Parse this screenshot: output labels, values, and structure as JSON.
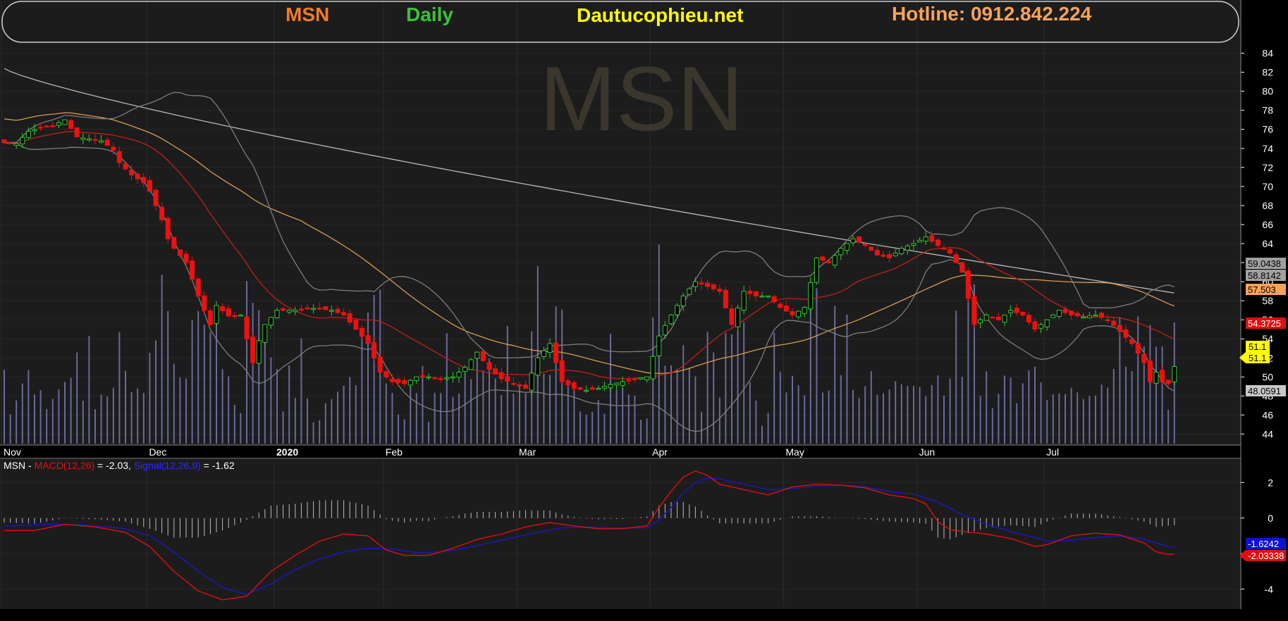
{
  "header": {
    "symbol": "MSN",
    "timeframe": "Daily",
    "website": "Dautucophieu.net",
    "hotline": "Hotline: 0912.842.224",
    "watermark": "MSN",
    "colors": {
      "symbol": "#f07a2c",
      "timeframe": "#3ac23a",
      "website": "#ffff00",
      "hotline": "#f7a35c"
    }
  },
  "macd_legend": {
    "symbol": "MSN",
    "dash": " - ",
    "macd_label": "MACD(12,26)",
    "macd_value": " = -2.03, ",
    "signal_label": "Signal(12,26,9)",
    "signal_value": " = -1.62"
  },
  "tags": {
    "upper_band": "59.0438",
    "ma200": "58.8142",
    "ma50": "57.503",
    "ma20": "54.3725",
    "close_a": "51.1",
    "close_b": "51.1",
    "lower_band": "48.0591",
    "signal": "-1.6242",
    "macd": "-2.03338"
  },
  "chart_data": [
    {
      "type": "candlestick",
      "title": "MSN Daily",
      "y_ticks": [
        44,
        46,
        48,
        50,
        52,
        54,
        56,
        58,
        60,
        62,
        64,
        66,
        68,
        70,
        72,
        74,
        76,
        78,
        80,
        82,
        84
      ],
      "ylim": [
        43,
        85
      ],
      "x_month_labels": [
        "Nov",
        "Dec",
        "2020",
        "Feb",
        "Mar",
        "Apr",
        "May",
        "Jun",
        "Jul"
      ],
      "x_month_index": [
        0,
        24,
        45,
        63,
        85,
        107,
        129,
        151,
        172
      ],
      "anchors": [
        [
          0,
          74.6
        ],
        [
          2,
          74.5
        ],
        [
          4,
          75.8
        ],
        [
          6,
          76.2
        ],
        [
          8,
          76.4
        ],
        [
          10,
          77.0
        ],
        [
          12,
          75.2
        ],
        [
          14,
          75.0
        ],
        [
          16,
          74.8
        ],
        [
          18,
          73.8
        ],
        [
          19,
          72.5
        ],
        [
          21,
          71.2
        ],
        [
          23,
          70.4
        ],
        [
          24,
          69.5
        ],
        [
          26,
          66.5
        ],
        [
          27,
          64.5
        ],
        [
          28,
          63.5
        ],
        [
          30,
          62.0
        ],
        [
          32,
          58.5
        ],
        [
          33,
          57.0
        ],
        [
          34,
          55.5
        ],
        [
          35,
          57.5
        ],
        [
          37,
          56.4
        ],
        [
          39,
          56.5
        ],
        [
          41,
          51.5
        ],
        [
          42,
          53.8
        ],
        [
          43,
          55.5
        ],
        [
          45,
          57.0
        ],
        [
          48,
          57.0
        ],
        [
          51,
          57.2
        ],
        [
          54,
          57.0
        ],
        [
          56,
          56.5
        ],
        [
          58,
          55.0
        ],
        [
          60,
          53.5
        ],
        [
          62,
          50.5
        ],
        [
          64,
          49.5
        ],
        [
          66,
          49.3
        ],
        [
          68,
          50.0
        ],
        [
          70,
          50.0
        ],
        [
          72,
          49.8
        ],
        [
          74,
          50.0
        ],
        [
          76,
          51.0
        ],
        [
          78,
          52.6
        ],
        [
          80,
          50.8
        ],
        [
          82,
          49.8
        ],
        [
          84,
          49.3
        ],
        [
          86,
          48.8
        ],
        [
          88,
          52.0
        ],
        [
          90,
          53.5
        ],
        [
          92,
          49.5
        ],
        [
          94,
          48.8
        ],
        [
          96,
          48.6
        ],
        [
          98,
          48.8
        ],
        [
          100,
          49.2
        ],
        [
          102,
          49.5
        ],
        [
          104,
          49.8
        ],
        [
          106,
          50.0
        ],
        [
          108,
          54.3
        ],
        [
          110,
          56.5
        ],
        [
          112,
          58.5
        ],
        [
          114,
          60.0
        ],
        [
          116,
          59.5
        ],
        [
          118,
          59.0
        ],
        [
          120,
          55.5
        ],
        [
          122,
          59.0
        ],
        [
          124,
          58.5
        ],
        [
          126,
          58.5
        ],
        [
          128,
          57.3
        ],
        [
          130,
          56.5
        ],
        [
          132,
          57.3
        ],
        [
          134,
          62.5
        ],
        [
          136,
          62.0
        ],
        [
          138,
          63.5
        ],
        [
          140,
          64.5
        ],
        [
          142,
          63.8
        ],
        [
          144,
          62.8
        ],
        [
          146,
          62.5
        ],
        [
          148,
          63.5
        ],
        [
          150,
          64.0
        ],
        [
          152,
          64.7
        ],
        [
          154,
          63.8
        ],
        [
          156,
          63.0
        ],
        [
          158,
          61.0
        ],
        [
          160,
          55.5
        ],
        [
          162,
          56.5
        ],
        [
          164,
          56.0
        ],
        [
          166,
          57.0
        ],
        [
          168,
          56.5
        ],
        [
          170,
          55.0
        ],
        [
          172,
          56.0
        ],
        [
          174,
          57.0
        ],
        [
          176,
          56.5
        ],
        [
          178,
          56.3
        ],
        [
          180,
          56.5
        ],
        [
          182,
          56.0
        ],
        [
          184,
          54.8
        ],
        [
          186,
          53.5
        ],
        [
          188,
          51.5
        ],
        [
          189,
          49.5
        ],
        [
          190,
          50.5
        ],
        [
          191,
          49.5
        ],
        [
          192,
          49.3
        ],
        [
          193,
          51.1
        ]
      ],
      "overlays": [
        {
          "name": "MA200",
          "color": "#b8b8b8",
          "last": 58.8142
        },
        {
          "name": "MA50",
          "color": "#d89a52",
          "last": 57.503
        },
        {
          "name": "MA20",
          "color": "#c0201a",
          "last": 54.3725
        },
        {
          "name": "Bollinger Upper",
          "color": "#7d7d7d",
          "last": 59.0438
        },
        {
          "name": "Bollinger Lower",
          "color": "#7d7d7d",
          "last": 48.0591
        }
      ],
      "last_close": 51.1
    },
    {
      "type": "line",
      "title": "MSN - MACD(12,26) = -2.03, Signal(12,26,9) = -1.62",
      "y_ticks": [
        -4,
        -2,
        0,
        2
      ],
      "ylim": [
        -5,
        3.2
      ],
      "series": [
        {
          "name": "MACD(12,26)",
          "color": "#e01010",
          "anchors": [
            [
              0,
              -0.7
            ],
            [
              5,
              -0.7
            ],
            [
              10,
              -0.35
            ],
            [
              15,
              -0.5
            ],
            [
              20,
              -0.8
            ],
            [
              24,
              -1.6
            ],
            [
              28,
              -3.0
            ],
            [
              32,
              -4.1
            ],
            [
              36,
              -4.6
            ],
            [
              40,
              -4.4
            ],
            [
              44,
              -3.0
            ],
            [
              48,
              -2.1
            ],
            [
              52,
              -1.3
            ],
            [
              56,
              -0.9
            ],
            [
              60,
              -1.0
            ],
            [
              63,
              -1.8
            ],
            [
              66,
              -2.1
            ],
            [
              70,
              -2.1
            ],
            [
              74,
              -1.7
            ],
            [
              78,
              -1.2
            ],
            [
              82,
              -0.9
            ],
            [
              86,
              -0.5
            ],
            [
              90,
              -0.25
            ],
            [
              94,
              -0.45
            ],
            [
              98,
              -0.6
            ],
            [
              102,
              -0.6
            ],
            [
              106,
              -0.45
            ],
            [
              108,
              0.6
            ],
            [
              110,
              1.5
            ],
            [
              112,
              2.3
            ],
            [
              114,
              2.65
            ],
            [
              116,
              2.4
            ],
            [
              118,
              1.9
            ],
            [
              122,
              1.6
            ],
            [
              126,
              1.3
            ],
            [
              130,
              1.75
            ],
            [
              134,
              1.9
            ],
            [
              138,
              1.85
            ],
            [
              142,
              1.7
            ],
            [
              146,
              1.3
            ],
            [
              150,
              1.1
            ],
            [
              152,
              0.8
            ],
            [
              154,
              -0.2
            ],
            [
              156,
              -0.65
            ],
            [
              158,
              -0.75
            ],
            [
              162,
              -0.9
            ],
            [
              166,
              -1.15
            ],
            [
              170,
              -1.6
            ],
            [
              172,
              -1.5
            ],
            [
              176,
              -1.0
            ],
            [
              180,
              -0.85
            ],
            [
              184,
              -0.95
            ],
            [
              188,
              -1.4
            ],
            [
              190,
              -1.9
            ],
            [
              192,
              -2.05
            ]
          ]
        },
        {
          "name": "Signal(12,26,9)",
          "color": "#1818c8",
          "anchors": [
            [
              0,
              -0.45
            ],
            [
              8,
              -0.35
            ],
            [
              14,
              -0.4
            ],
            [
              20,
              -0.6
            ],
            [
              24,
              -1.0
            ],
            [
              28,
              -1.9
            ],
            [
              32,
              -3.0
            ],
            [
              36,
              -3.9
            ],
            [
              40,
              -4.3
            ],
            [
              44,
              -3.7
            ],
            [
              48,
              -2.9
            ],
            [
              52,
              -2.3
            ],
            [
              56,
              -1.9
            ],
            [
              60,
              -1.7
            ],
            [
              64,
              -1.75
            ],
            [
              68,
              -1.95
            ],
            [
              72,
              -1.9
            ],
            [
              76,
              -1.7
            ],
            [
              80,
              -1.4
            ],
            [
              84,
              -1.1
            ],
            [
              88,
              -0.8
            ],
            [
              92,
              -0.55
            ],
            [
              96,
              -0.5
            ],
            [
              100,
              -0.55
            ],
            [
              106,
              -0.55
            ],
            [
              108,
              -0.1
            ],
            [
              110,
              0.6
            ],
            [
              112,
              1.4
            ],
            [
              114,
              2.0
            ],
            [
              116,
              2.25
            ],
            [
              118,
              2.2
            ],
            [
              122,
              1.9
            ],
            [
              126,
              1.6
            ],
            [
              130,
              1.65
            ],
            [
              134,
              1.8
            ],
            [
              138,
              1.85
            ],
            [
              142,
              1.75
            ],
            [
              146,
              1.5
            ],
            [
              150,
              1.35
            ],
            [
              154,
              0.9
            ],
            [
              158,
              0.2
            ],
            [
              162,
              -0.35
            ],
            [
              166,
              -0.75
            ],
            [
              170,
              -1.1
            ],
            [
              172,
              -1.3
            ],
            [
              176,
              -1.25
            ],
            [
              180,
              -1.1
            ],
            [
              184,
              -1.0
            ],
            [
              188,
              -1.2
            ],
            [
              190,
              -1.4
            ],
            [
              192,
              -1.62
            ]
          ]
        }
      ],
      "macd": -2.03,
      "signal": -1.62
    }
  ]
}
